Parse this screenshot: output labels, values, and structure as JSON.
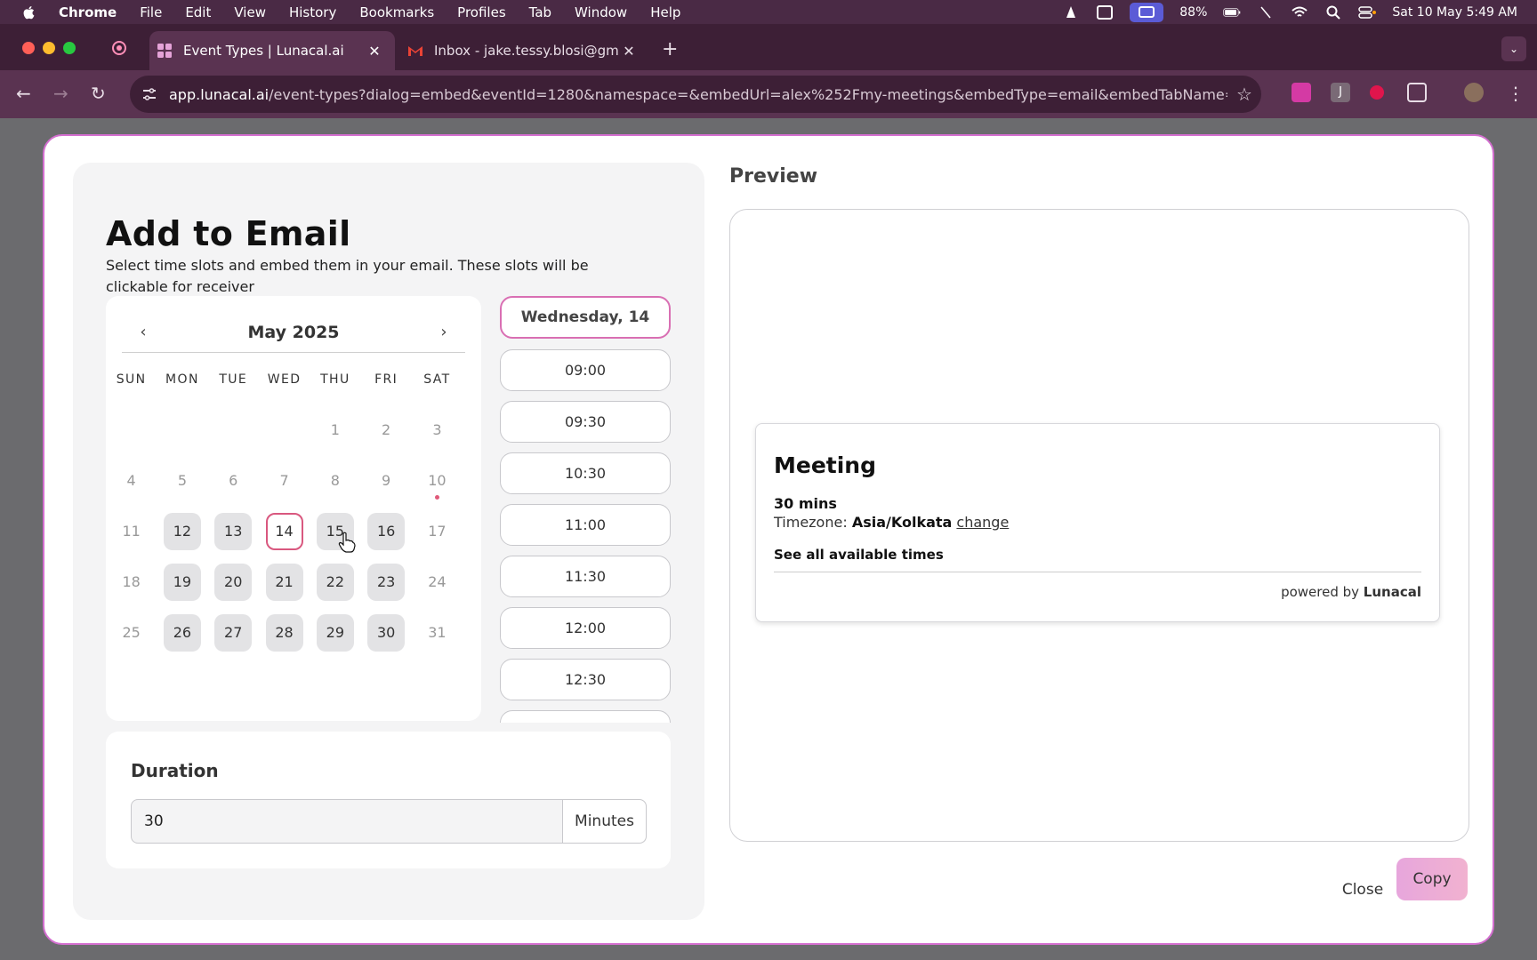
{
  "menubar": {
    "app": "Chrome",
    "items": [
      "File",
      "Edit",
      "View",
      "History",
      "Bookmarks",
      "Profiles",
      "Tab",
      "Window",
      "Help"
    ],
    "battery": "88%",
    "datetime": "Sat 10 May  5:49 AM"
  },
  "tabs": [
    {
      "title": "Event Types | Lunacal.ai",
      "icon": "lunacal-icon"
    },
    {
      "title": "Inbox - jake.tessy.blosi@gma",
      "icon": "gmail-icon"
    }
  ],
  "address": {
    "domain": "app.lunacal.ai",
    "path": "/event-types?dialog=embed&eventId=1280&namespace=&embedUrl=alex%252Fmy-meetings&embedType=email&embedTabName=e..."
  },
  "modal": {
    "title": "Add to Email",
    "subtitle": "Select time slots and embed them in your email. These slots will be clickable for receiver",
    "calendar": {
      "month": "May 2025",
      "dows": [
        "SUN",
        "MON",
        "TUE",
        "WED",
        "THU",
        "FRI",
        "SAT"
      ],
      "weeks": [
        [
          {
            "d": ""
          },
          {
            "d": ""
          },
          {
            "d": ""
          },
          {
            "d": ""
          },
          {
            "d": "1"
          },
          {
            "d": "2"
          },
          {
            "d": "3"
          }
        ],
        [
          {
            "d": "4"
          },
          {
            "d": "5"
          },
          {
            "d": "6"
          },
          {
            "d": "7"
          },
          {
            "d": "8"
          },
          {
            "d": "9"
          },
          {
            "d": "10",
            "today": true
          }
        ],
        [
          {
            "d": "11"
          },
          {
            "d": "12",
            "avail": true
          },
          {
            "d": "13",
            "avail": true
          },
          {
            "d": "14",
            "sel": true
          },
          {
            "d": "15",
            "avail": true
          },
          {
            "d": "16",
            "avail": true
          },
          {
            "d": "17"
          }
        ],
        [
          {
            "d": "18"
          },
          {
            "d": "19",
            "avail": true
          },
          {
            "d": "20",
            "avail": true
          },
          {
            "d": "21",
            "avail": true
          },
          {
            "d": "22",
            "avail": true
          },
          {
            "d": "23",
            "avail": true
          },
          {
            "d": "24"
          }
        ],
        [
          {
            "d": "25"
          },
          {
            "d": "26",
            "avail": true
          },
          {
            "d": "27",
            "avail": true
          },
          {
            "d": "28",
            "avail": true
          },
          {
            "d": "29",
            "avail": true
          },
          {
            "d": "30",
            "avail": true
          },
          {
            "d": "31"
          }
        ]
      ]
    },
    "slots": {
      "selected_day": "Wednesday, 14",
      "times": [
        "09:00",
        "09:30",
        "10:30",
        "11:00",
        "11:30",
        "12:00",
        "12:30",
        ""
      ]
    },
    "duration": {
      "label": "Duration",
      "value": "30",
      "unit": "Minutes"
    },
    "preview": {
      "label": "Preview",
      "card_title": "Meeting",
      "card_duration": "30 mins",
      "tz_prefix": "Timezone: ",
      "tz_value": "Asia/Kolkata",
      "tz_change": "change",
      "see_all": "See all available times",
      "powered_prefix": "powered by ",
      "powered_brand": "Lunacal"
    },
    "close_label": "Close",
    "copy_label": "Copy"
  }
}
